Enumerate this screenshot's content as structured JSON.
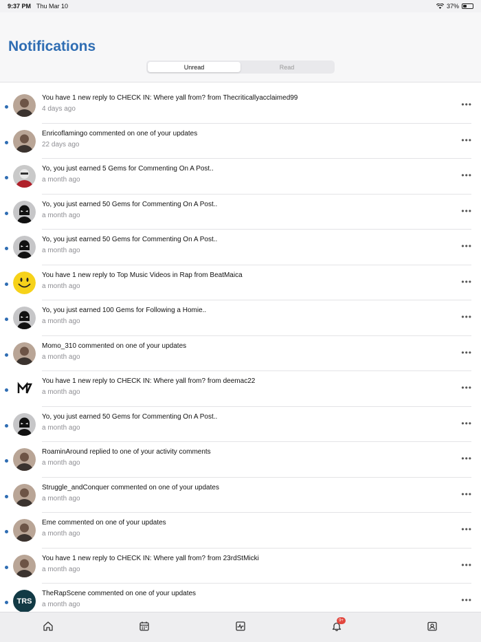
{
  "status": {
    "time": "9:37 PM",
    "date": "Thu Mar 10",
    "battery": "37%",
    "battery_level": 0.37
  },
  "header": {
    "title": "Notifications",
    "tabs": [
      {
        "label": "Unread",
        "active": true
      },
      {
        "label": "Read",
        "active": false
      }
    ]
  },
  "notifications": [
    {
      "text": "You have 1 new reply to CHECK IN: Where yall from? from Thecriticallyacclaimed99",
      "time": "4 days ago",
      "avatar": "person-avatar"
    },
    {
      "text": "Enricoflamingo commented on one of your updates",
      "time": "22 days ago",
      "avatar": "person-avatar"
    },
    {
      "text": "Yo, you just earned 5 Gems for Commenting On A Post..",
      "time": "a month ago",
      "avatar": "masked-figure-avatar"
    },
    {
      "text": "Yo, you just earned 50 Gems for Commenting On A Post..",
      "time": "a month ago",
      "avatar": "ski-mask-avatar"
    },
    {
      "text": "Yo, you just earned 50 Gems for Commenting On A Post..",
      "time": "a month ago",
      "avatar": "ski-mask-avatar"
    },
    {
      "text": "You have 1 new reply to Top Music Videos in Rap from BeatMaica",
      "time": "a month ago",
      "avatar": "smiley-avatar"
    },
    {
      "text": "Yo, you just earned 100 Gems for Following a Homie..",
      "time": "a month ago",
      "avatar": "ski-mask-avatar"
    },
    {
      "text": "Momo_310 commented on one of your updates",
      "time": "a month ago",
      "avatar": "person-avatar"
    },
    {
      "text": "You have 1 new reply to CHECK IN: Where yall from? from deemac22",
      "time": "a month ago",
      "avatar": "logo-avatar"
    },
    {
      "text": "Yo, you just earned 50 Gems for Commenting On A Post..",
      "time": "a month ago",
      "avatar": "ski-mask-avatar"
    },
    {
      "text": "RoaminAround replied to one of your activity comments",
      "time": "a month ago",
      "avatar": "person-avatar"
    },
    {
      "text": "Struggle_andConquer commented on one of your updates",
      "time": "a month ago",
      "avatar": "person-avatar"
    },
    {
      "text": "Eme commented on one of your updates",
      "time": "a month ago",
      "avatar": "person-avatar"
    },
    {
      "text": "You have 1 new reply to CHECK IN: Where yall from? from 23rdStMicki",
      "time": "a month ago",
      "avatar": "person-avatar"
    },
    {
      "text": "TheRapScene commented on one of your updates",
      "time": "a month ago",
      "avatar": "trs-logo-avatar",
      "avatar_text": "TRS"
    }
  ],
  "tabbar": {
    "items": [
      "home-icon",
      "calendar-icon",
      "activity-icon",
      "bell-icon",
      "profile-icon"
    ],
    "badge": "9+"
  },
  "colors": {
    "accent": "#2f6db3",
    "unread_dot": "#2f6db3",
    "badge": "#e2463e"
  }
}
